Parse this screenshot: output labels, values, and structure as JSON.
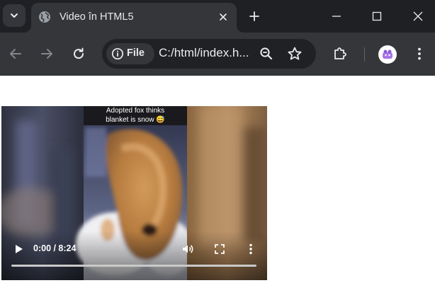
{
  "browser": {
    "tab": {
      "title": "Video în HTML5",
      "favicon": "globe-icon"
    },
    "toolbar": {
      "security_chip_label": "File",
      "url": "C:/html/index.h..."
    }
  },
  "page": {
    "video": {
      "caption_line1": "Adopted fox thinks",
      "caption_line2": "blanket is snow 😅",
      "current_time": "0:00",
      "duration": "8:24",
      "time_display": "0:00 / 8:24",
      "progress": 0,
      "state": "paused"
    }
  },
  "colors": {
    "tabstrip_bg": "#1f2024",
    "toolbar_bg": "#35363a",
    "omnibox_bg": "#202124",
    "page_bg": "#ffffff"
  }
}
